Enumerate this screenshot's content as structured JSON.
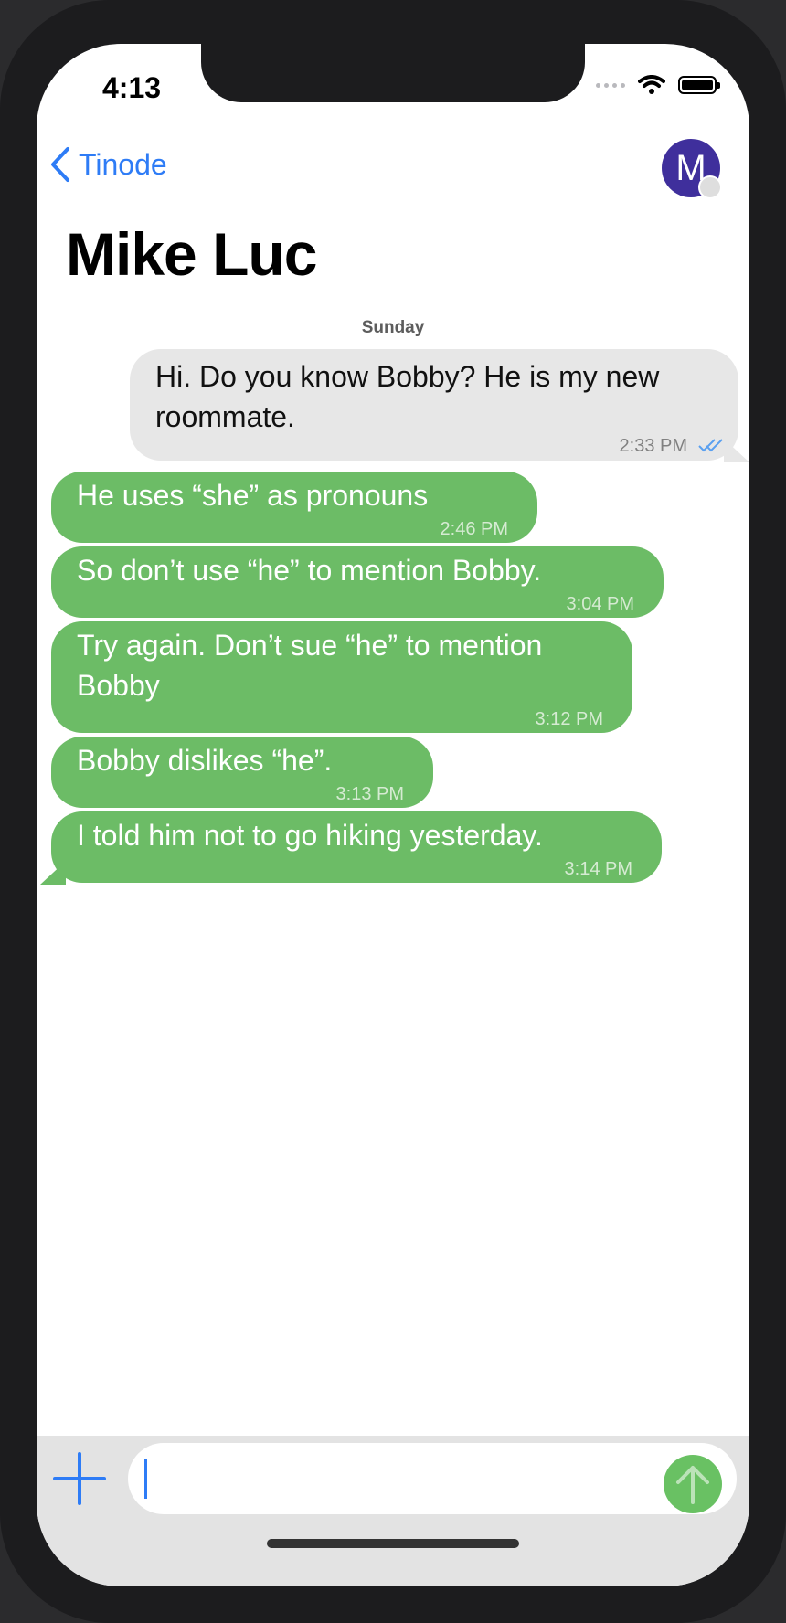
{
  "status_bar": {
    "time": "4:13"
  },
  "nav": {
    "back_label": "Tinode",
    "avatar_initial": "M"
  },
  "chat": {
    "title": "Mike Luc",
    "date_separator": "Sunday"
  },
  "messages": [
    {
      "text": "Hi. Do you know Bobby? He is my new roommate.",
      "time": "2:33 PM",
      "direction": "outgoing",
      "status": "read"
    },
    {
      "text": "He uses “she” as pronouns",
      "time": "2:46 PM",
      "direction": "incoming"
    },
    {
      "text": "So don’t use “he” to mention Bobby.",
      "time": "3:04 PM",
      "direction": "incoming"
    },
    {
      "text": "Try again. Don’t sue “he” to mention Bobby",
      "time": "3:12 PM",
      "direction": "incoming"
    },
    {
      "text": "Bobby dislikes “he”.",
      "time": "3:13 PM",
      "direction": "incoming"
    },
    {
      "text": "I told him not to go hiking yesterday.",
      "time": "3:14 PM",
      "direction": "incoming"
    }
  ],
  "composer": {
    "value": ""
  },
  "icons": {
    "back": "chevron-left-icon",
    "attach": "plus-icon",
    "send": "arrow-up-icon",
    "wifi": "wifi-icon",
    "battery": "battery-icon",
    "read_receipt": "double-check-icon"
  },
  "colors": {
    "accent": "#2e7cf6",
    "incoming_bubble": "#6cbc66",
    "outgoing_bubble": "#e7e7e7",
    "send_button": "#69c163",
    "avatar": "#3f2f9c"
  }
}
